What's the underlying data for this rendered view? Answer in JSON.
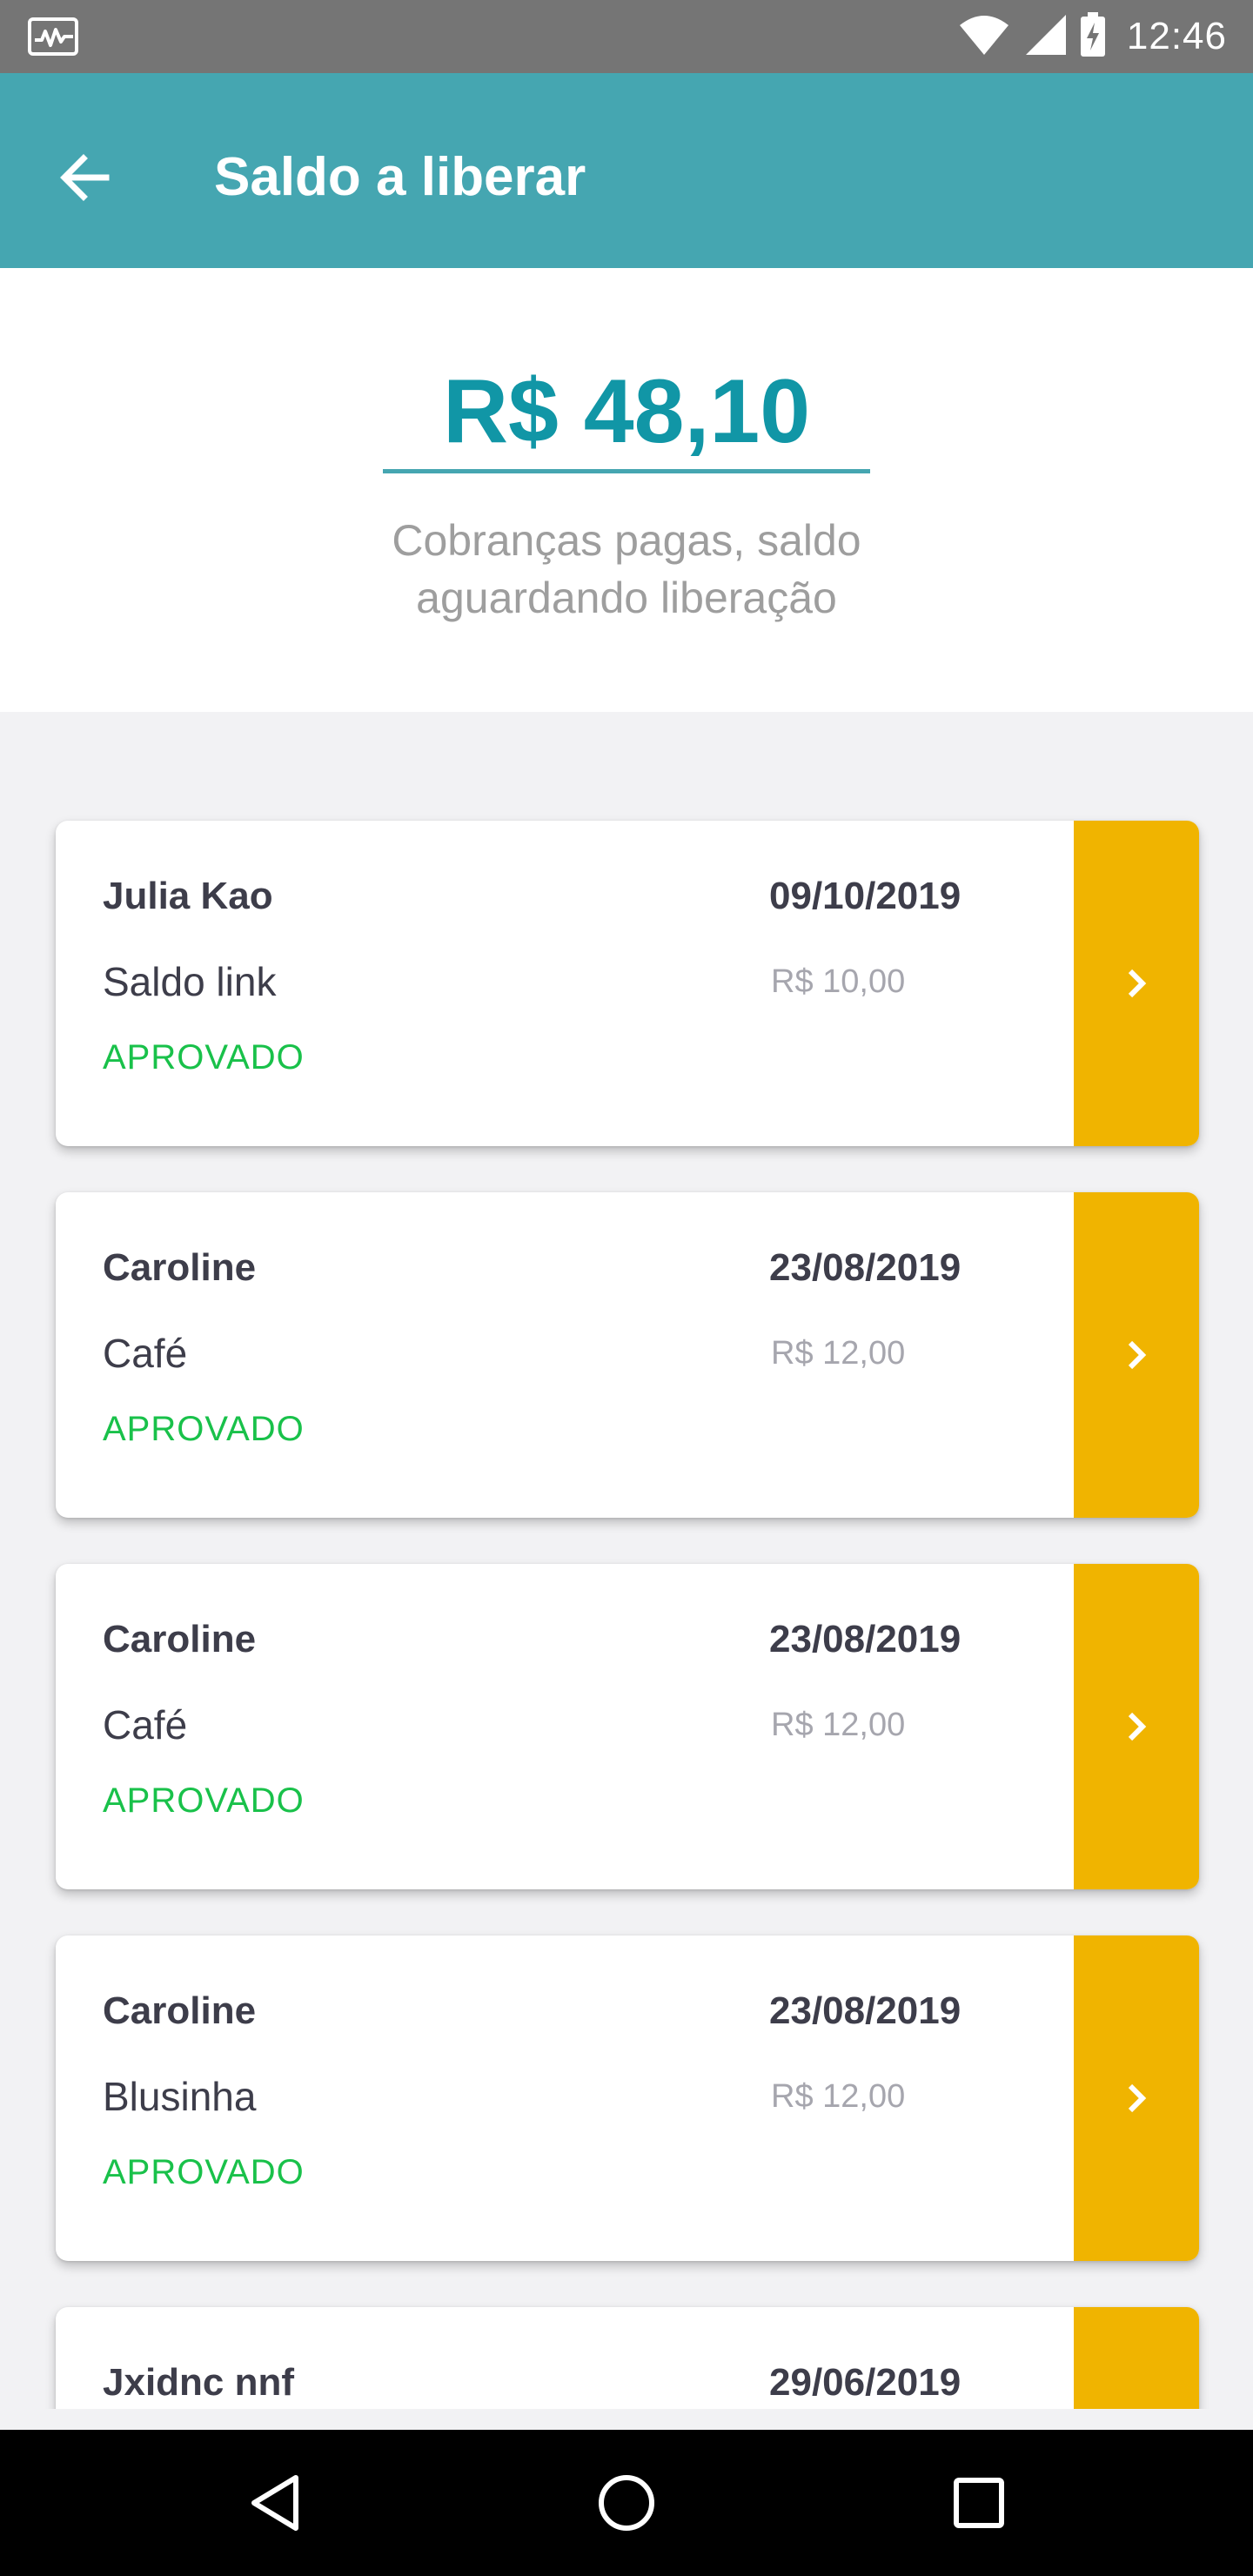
{
  "status_bar": {
    "time": "12:46",
    "icons": [
      "activity-icon",
      "wifi-icon",
      "signal-icon",
      "battery-charging-icon"
    ]
  },
  "app_bar": {
    "title": "Saldo a liberar",
    "back_icon": "arrow-left-icon"
  },
  "balance": {
    "amount": "R$ 48,10",
    "caption_line1": "Cobranças pagas, saldo",
    "caption_line2": "aguardando liberação"
  },
  "transactions": [
    {
      "name": "Julia Kao",
      "description": "Saldo link",
      "status": "APROVADO",
      "date": "09/10/2019",
      "value": "R$ 10,00"
    },
    {
      "name": "Caroline",
      "description": "Café",
      "status": "APROVADO",
      "date": "23/08/2019",
      "value": "R$ 12,00"
    },
    {
      "name": "Caroline",
      "description": "Café",
      "status": "APROVADO",
      "date": "23/08/2019",
      "value": "R$ 12,00"
    },
    {
      "name": "Caroline",
      "description": "Blusinha",
      "status": "APROVADO",
      "date": "23/08/2019",
      "value": "R$ 12,00"
    },
    {
      "name": "Jxidnc nnf",
      "description": "",
      "status": "",
      "date": "29/06/2019",
      "value": ""
    }
  ],
  "colors": {
    "app_bar": "#45a6b1",
    "amount": "#1196a6",
    "status_approved": "#19c14a",
    "action_button": "#f0b400"
  },
  "nav_bar": {
    "icons": [
      "back-triangle-icon",
      "home-circle-icon",
      "recents-square-icon"
    ]
  }
}
